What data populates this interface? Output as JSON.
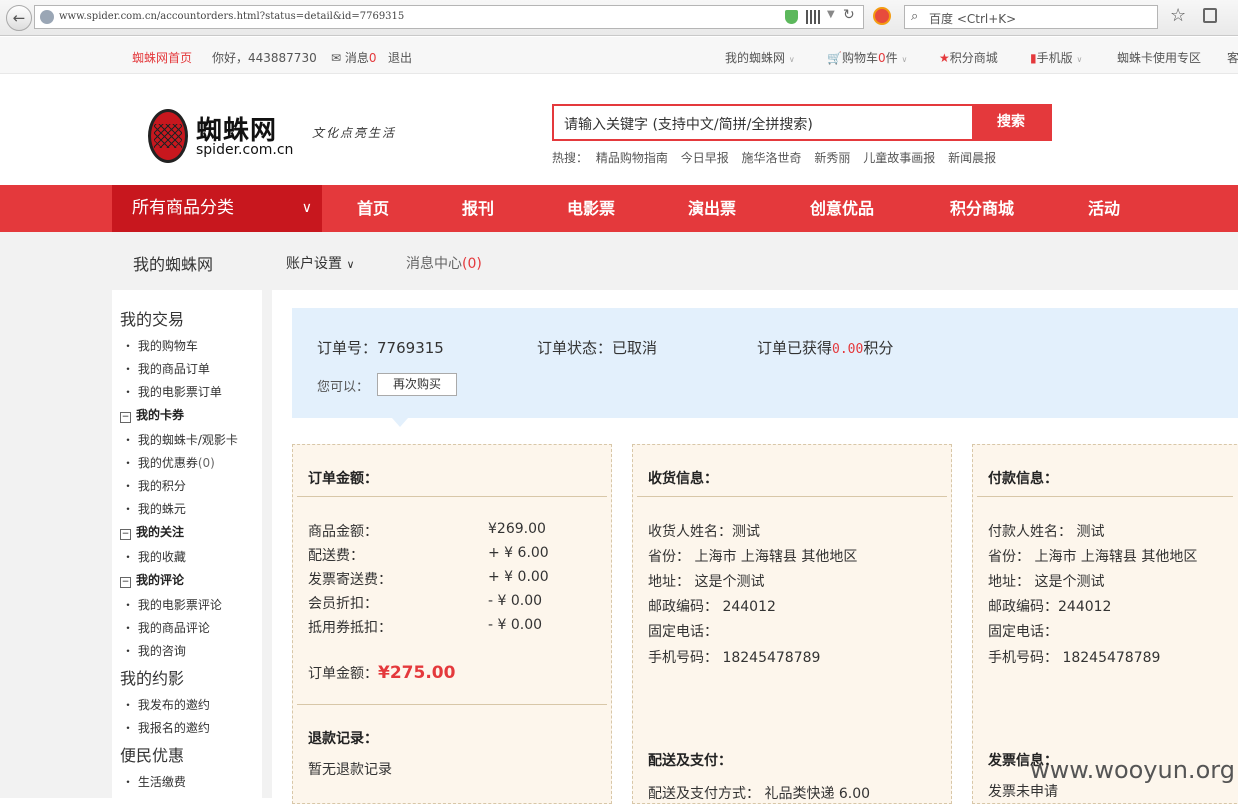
{
  "browser": {
    "url": "www.spider.com.cn/accountorders.html?status=detail&id=7769315",
    "search_placeholder": "百度 <Ctrl+K>"
  },
  "topbar": {
    "home_link": "蜘蛛网首页",
    "greeting": "你好，443887730",
    "messages_label": "消息",
    "messages_count": "0",
    "logout": "退出",
    "my_spider": "我的蜘蛛网",
    "cart_label": "购物车",
    "cart_count": "0",
    "cart_unit": "件",
    "points_mall": "积分商城",
    "mobile": "手机版",
    "card_zone": "蜘蛛卡使用专区",
    "more": "客"
  },
  "header": {
    "logo_name": "蜘蛛网",
    "logo_domain": "spider.com.cn",
    "slogan": "文化点亮生活",
    "search_placeholder": "请输入关键字 (支持中文/简拼/全拼搜索)",
    "search_button": "搜索",
    "hot_label": "热搜：",
    "hot_items": [
      "精品购物指南",
      "今日早报",
      "施华洛世奇",
      "新秀丽",
      "儿童故事画报",
      "新闻晨报"
    ]
  },
  "nav": {
    "all_categories": "所有商品分类",
    "items": [
      "首页",
      "报刊",
      "电影票",
      "演出票",
      "创意优品",
      "积分商城",
      "活动"
    ]
  },
  "subbar": {
    "title": "我的蜘蛛网",
    "account_settings": "账户设置",
    "message_center": "消息中心",
    "message_count": "(0)"
  },
  "sidebar": {
    "sections": [
      {
        "title": "我的交易",
        "items": [
          "我的购物车",
          "我的商品订单",
          "我的电影票订单"
        ]
      },
      {
        "title": "我的卡券",
        "items": [
          "我的蜘蛛卡/观影卡",
          "我的优惠券",
          "我的积分",
          "我的蛛元"
        ],
        "coupon_count": "(0)"
      },
      {
        "title": "我的关注",
        "items": [
          "我的收藏"
        ]
      },
      {
        "title": "我的评论",
        "items": [
          "我的电影票评论",
          "我的商品评论",
          "我的咨询"
        ]
      },
      {
        "title": "我的约影",
        "items": [
          "我发布的邀约",
          "我报名的邀约"
        ]
      },
      {
        "title": "便民优惠",
        "items": [
          "生活缴费"
        ]
      }
    ]
  },
  "order": {
    "number_label": "订单号：",
    "number": "7769315",
    "status_label": "订单状态：",
    "status": "已取消",
    "points_label": "订单已获得",
    "points": "0.00",
    "points_unit": "积分",
    "you_can": "您可以：",
    "rebuy": "再次购买"
  },
  "amount_card": {
    "title": "订单金额：",
    "rows": [
      {
        "label": "商品金额：",
        "value": "¥269.00"
      },
      {
        "label": "配送费：",
        "value": "+ ¥ 6.00"
      },
      {
        "label": "发票寄送费：",
        "value": "+ ¥ 0.00"
      },
      {
        "label": "会员折扣：",
        "value": "- ¥ 0.00"
      },
      {
        "label": "抵用券抵扣：",
        "value": "- ¥ 0.00"
      }
    ],
    "total_label": "订单金额：",
    "total_value": "¥275.00",
    "refund_title": "退款记录：",
    "refund_text": "暂无退款记录"
  },
  "shipping_card": {
    "title": "收货信息：",
    "rows": [
      {
        "label": "收货人姓名：",
        "value": "测试"
      },
      {
        "label": "省份：",
        "value": "上海市 上海辖县 其他地区"
      },
      {
        "label": "地址：",
        "value": "这是个测试"
      },
      {
        "label": "邮政编码：",
        "value": "244012"
      },
      {
        "label": "固定电话：",
        "value": ""
      },
      {
        "label": "手机号码：",
        "value": "18245478789"
      }
    ],
    "delivery_title": "配送及支付：",
    "delivery_label": "配送及支付方式：",
    "delivery_value": "礼品类快递 6.00"
  },
  "payment_card": {
    "title": "付款信息：",
    "rows": [
      {
        "label": "付款人姓名：",
        "value": "测试"
      },
      {
        "label": "省份：",
        "value": "上海市 上海辖县 其他地区"
      },
      {
        "label": "地址：",
        "value": "这是个测试"
      },
      {
        "label": "邮政编码：",
        "value": "244012"
      },
      {
        "label": "固定电话：",
        "value": ""
      },
      {
        "label": "手机号码：",
        "value": "18245478789"
      }
    ],
    "invoice_title": "发票信息：",
    "invoice_text": "发票未申请"
  },
  "watermark": "www.wooyun.org",
  "colors": {
    "brand_red": "#e4393c",
    "dark_red": "#c8171e",
    "info_blue": "#e3f0fc",
    "card_bg": "#fdf6ec"
  }
}
